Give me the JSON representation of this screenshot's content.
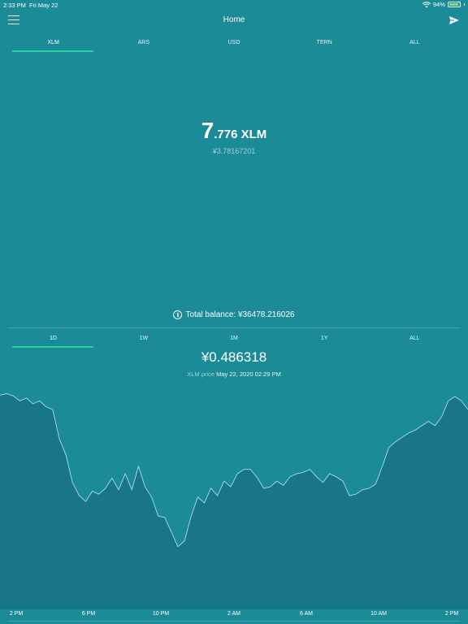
{
  "status_bar": {
    "time": "2:33 PM",
    "date": "Fri May 22",
    "battery": "94%",
    "battery_level": 0.94
  },
  "nav": {
    "title": "Home",
    "menu_icon": "hamburger-menu-icon",
    "send_icon": "send-icon"
  },
  "currency_tabs": [
    "XLM",
    "ARS",
    "USD",
    "TERN",
    "ALL"
  ],
  "active_currency": "XLM",
  "balance": {
    "integer": "7",
    "rest": ".776 XLM",
    "fiat": "¥3.78167201"
  },
  "total_balance": "Total balance: ¥36478.216026",
  "range_tabs": [
    "1D",
    "1W",
    "1M",
    "1Y",
    "ALL"
  ],
  "active_range": "1D",
  "price": {
    "value": "¥0.486318",
    "label": "XLM price",
    "timestamp": "May 22, 2020 02:29 PM"
  },
  "colors": {
    "background": "#1b8b98",
    "chart_fill": "#18758a",
    "chart_line": "#a7dde6",
    "accent": "#2ad3a0"
  },
  "chart_data": {
    "type": "area",
    "title": "",
    "xlabel": "",
    "ylabel": "",
    "x_ticks": [
      "2 PM",
      "6 PM",
      "10 PM",
      "2 AM",
      "6 AM",
      "10 AM",
      "2 PM"
    ],
    "x_range": [
      0,
      24
    ],
    "ylim": [
      0.4605,
      0.4895
    ],
    "grid": false,
    "values": [
      0.4888,
      0.489,
      0.4887,
      0.488,
      0.4884,
      0.4876,
      0.488,
      0.4872,
      0.4868,
      0.4828,
      0.4806,
      0.4768,
      0.475,
      0.4742,
      0.4756,
      0.4752,
      0.476,
      0.4774,
      0.4758,
      0.478,
      0.4758,
      0.479,
      0.4762,
      0.4748,
      0.4722,
      0.472,
      0.47,
      0.468,
      0.4688,
      0.4722,
      0.4748,
      0.474,
      0.476,
      0.475,
      0.477,
      0.4762,
      0.478,
      0.4786,
      0.4786,
      0.4775,
      0.476,
      0.4762,
      0.477,
      0.4764,
      0.4776,
      0.478,
      0.4782,
      0.4786,
      0.4776,
      0.4768,
      0.478,
      0.4776,
      0.477,
      0.475,
      0.4752,
      0.4758,
      0.476,
      0.4766,
      0.479,
      0.4816,
      0.4824,
      0.483,
      0.4836,
      0.484,
      0.4846,
      0.4852,
      0.4846,
      0.4858,
      0.488,
      0.4886,
      0.488,
      0.4868
    ]
  }
}
